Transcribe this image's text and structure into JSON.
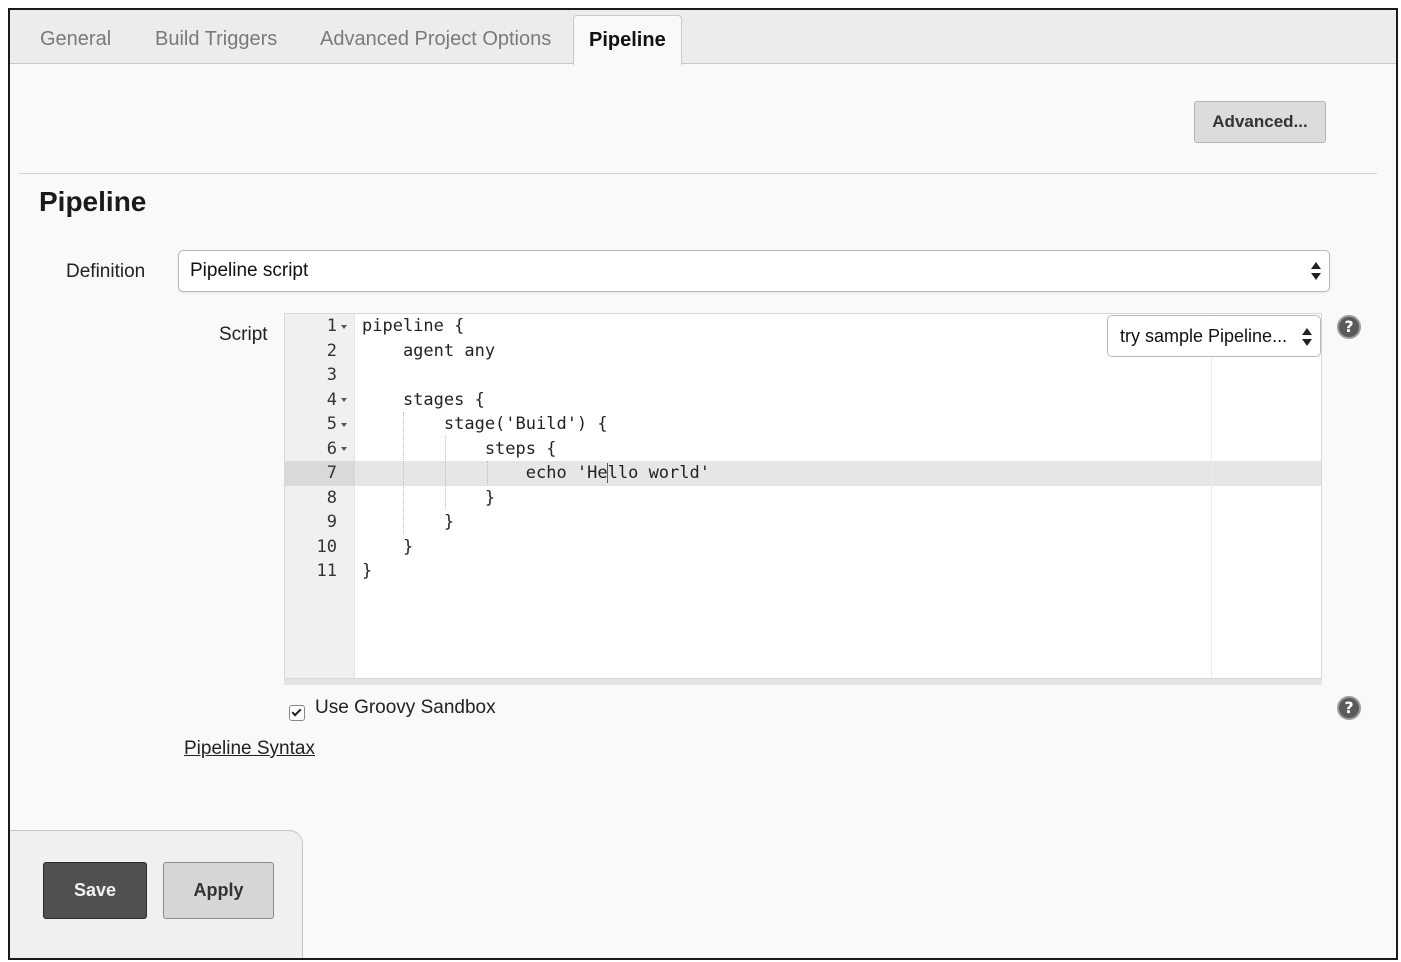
{
  "tabs": [
    {
      "label": "General",
      "active": false
    },
    {
      "label": "Build Triggers",
      "active": false
    },
    {
      "label": "Advanced Project Options",
      "active": false
    },
    {
      "label": "Pipeline",
      "active": true
    }
  ],
  "advanced_button": "Advanced...",
  "section": {
    "title": "Pipeline"
  },
  "definition": {
    "label": "Definition",
    "value": "Pipeline script"
  },
  "script": {
    "label": "Script",
    "sample_select": "try sample Pipeline...",
    "line_numbers": [
      "1",
      "2",
      "3",
      "4",
      "5",
      "6",
      "7",
      "8",
      "9",
      "10",
      "11"
    ],
    "highlighted_line": 7,
    "lines": [
      "pipeline {",
      "    agent any",
      "",
      "    stages {",
      "        stage('Build') {",
      "            steps {",
      "                echo 'Hello world'",
      "            }",
      "        }",
      "    }",
      "}"
    ]
  },
  "sandbox": {
    "label": "Use Groovy Sandbox",
    "checked": true
  },
  "pipeline_syntax_link": "Pipeline Syntax",
  "help_icon": "?",
  "actions": {
    "save": "Save",
    "apply": "Apply"
  }
}
